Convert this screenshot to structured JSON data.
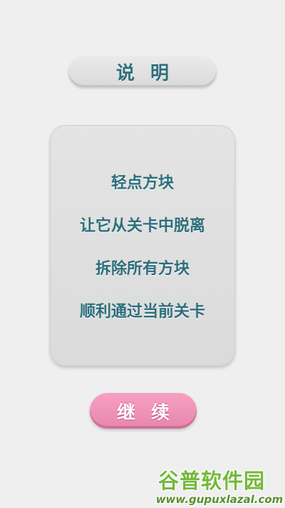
{
  "header": {
    "title": "说明"
  },
  "instructions": {
    "lines": [
      "轻点方块",
      "让它从关卡中脱离",
      "拆除所有方块",
      "顺利通过当前关卡"
    ]
  },
  "actions": {
    "continue_label": "继续"
  },
  "watermark": {
    "title": "谷普软件园",
    "url": "www.gupuxlazal.com"
  },
  "colors": {
    "background": "#f0eff0",
    "text_teal": "#2f6f7d",
    "button_pink": "#ef92b8",
    "watermark_green": "#74b83a"
  }
}
